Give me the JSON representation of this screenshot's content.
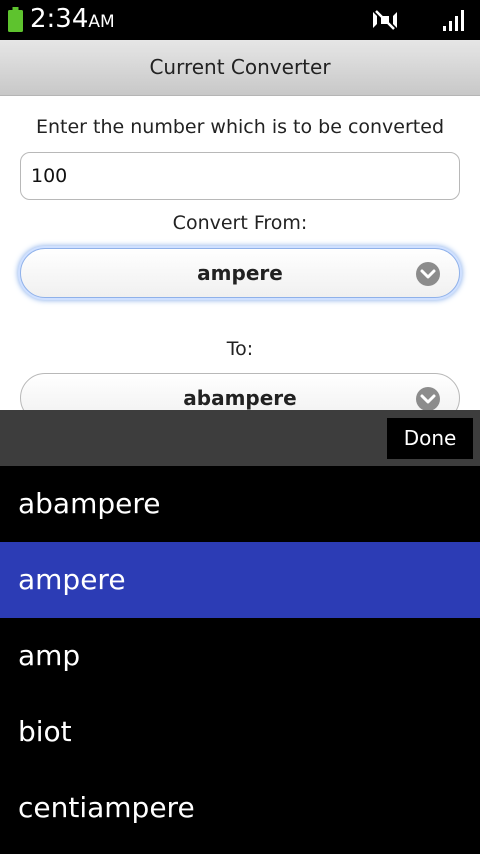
{
  "status_bar": {
    "time": "2:34",
    "ampm": "AM",
    "icons": [
      "battery-icon",
      "mute-icon",
      "signal-icon"
    ]
  },
  "title": "Current Converter",
  "form": {
    "number_label": "Enter the number which is to be converted",
    "number_value": "100",
    "from_label": "Convert From:",
    "from_value": "ampere",
    "to_label": "To:",
    "to_value": "abampere"
  },
  "picker": {
    "done_label": "Done",
    "options": [
      "abampere",
      "ampere",
      "amp",
      "biot",
      "centiampere"
    ],
    "selected": "ampere"
  },
  "colors": {
    "selection": "#2c3cb5",
    "battery": "#5ec32e",
    "focus_glow": "#7ea8e8"
  }
}
